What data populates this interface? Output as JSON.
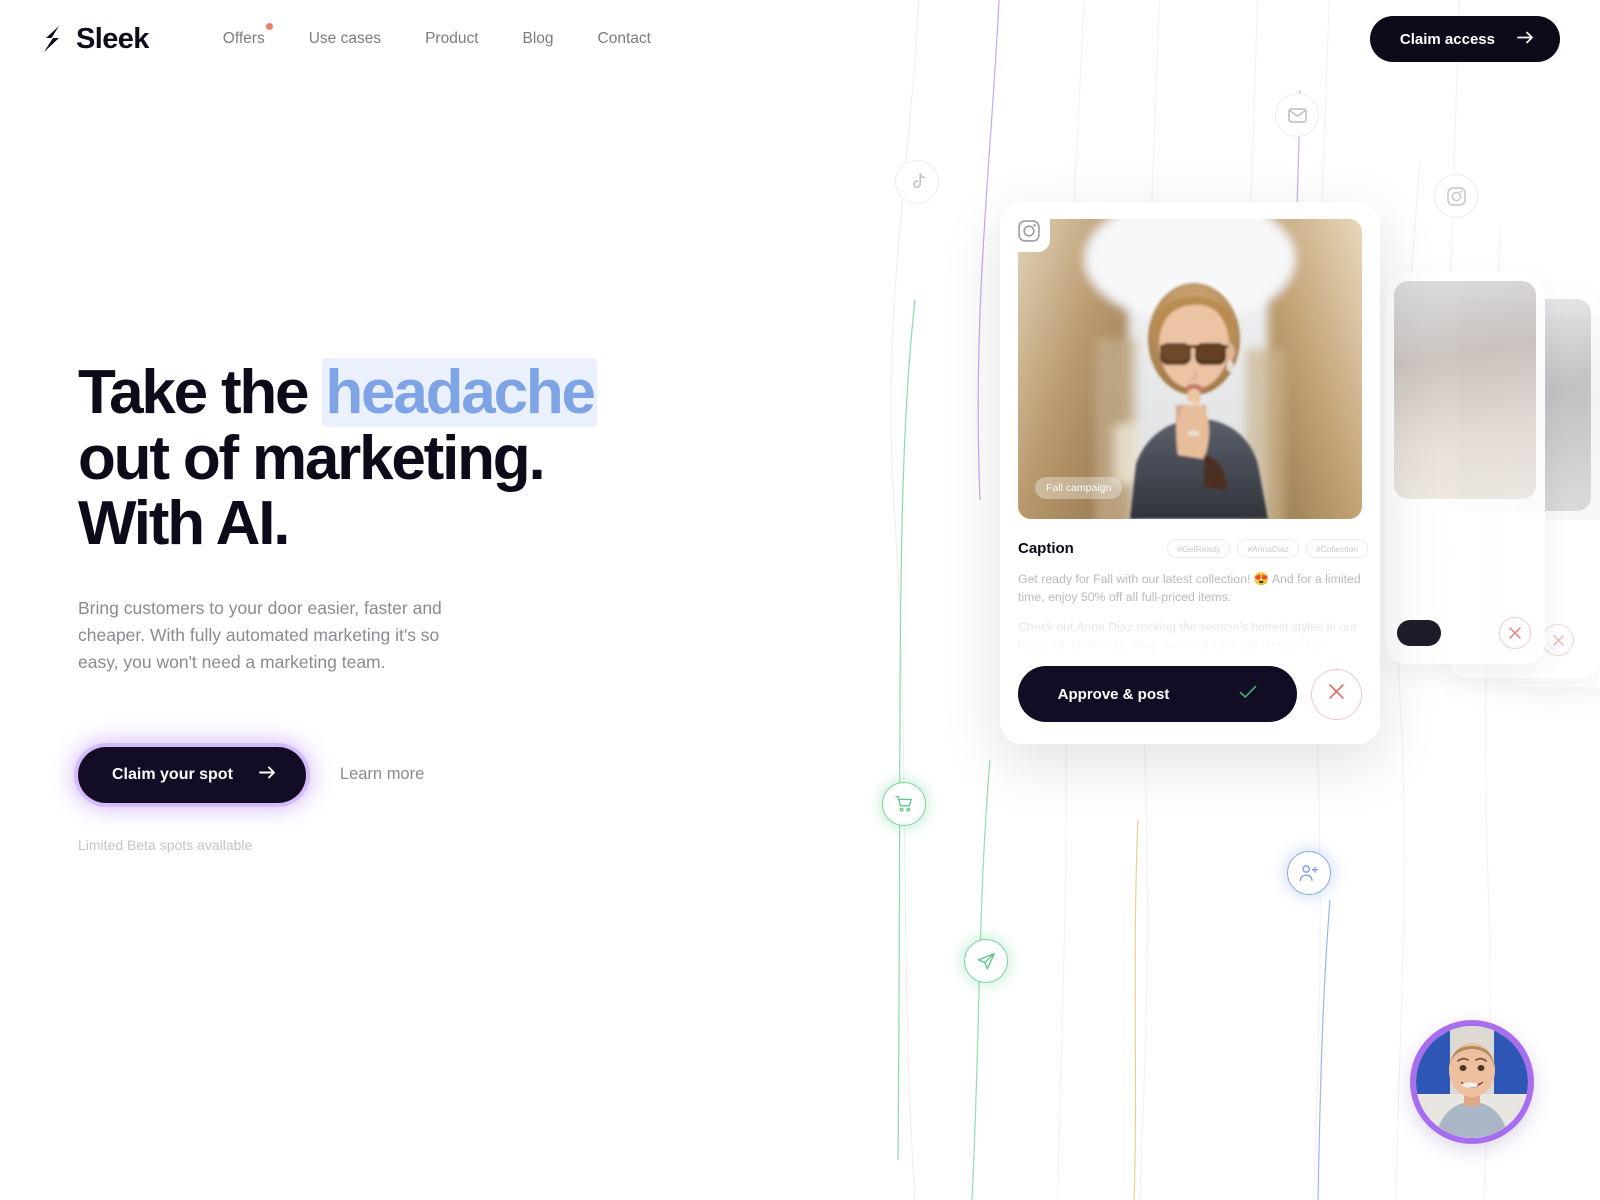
{
  "brand": {
    "name": "Sleek",
    "logo_icon": "sleek-logo-mark"
  },
  "nav": {
    "links": [
      {
        "label": "Offers",
        "badge": true
      },
      {
        "label": "Use cases",
        "badge": false
      },
      {
        "label": "Product",
        "badge": false
      },
      {
        "label": "Blog",
        "badge": false
      },
      {
        "label": "Contact",
        "badge": false
      }
    ],
    "cta": {
      "label": "Claim access",
      "icon": "arrow-right-icon"
    }
  },
  "hero": {
    "headline_part1": "Take the ",
    "headline_accent": "headache",
    "headline_part2": "out of marketing. With AI.",
    "headline_line2": "out of marketing.",
    "headline_line3": "With AI.",
    "subtitle": "Bring customers to your door easier, faster and cheaper. With fully automated marketing it's so easy, you won't need a marketing team.",
    "primary_cta": {
      "label": "Claim your spot",
      "icon": "arrow-right-icon"
    },
    "secondary_cta": {
      "label": "Learn more"
    },
    "note": "Limited Beta spots available"
  },
  "visual": {
    "float_icons": [
      {
        "name": "tiktok-icon",
        "style": "grey"
      },
      {
        "name": "mail-icon",
        "style": "grey"
      },
      {
        "name": "instagram-icon",
        "style": "grey"
      },
      {
        "name": "shopping-cart-icon",
        "style": "green"
      },
      {
        "name": "send-icon",
        "style": "green"
      },
      {
        "name": "user-plus-icon",
        "style": "blue"
      }
    ],
    "card": {
      "platform_icon": "instagram-icon",
      "image_badge": "Fall campaign",
      "caption_title": "Caption",
      "tags": [
        "#GetReady",
        "#AnnaDiaz",
        "#Collection"
      ],
      "body_p1": "Get ready for Fall with our latest collection! 😍 And for a limited time, enjoy 50% off all full-priced items.",
      "body_p2": "Check out Anna Diaz rocking the season's hottest styles in our latest ad. Don't wait, shop now and save big on your Fall",
      "approve_label": "Approve & post",
      "approve_icon": "check-icon",
      "reject_icon": "close-icon"
    },
    "ghost_cards": [
      {
        "reject_icon": "close-icon"
      },
      {
        "reject_icon": "close-icon"
      },
      {
        "reject_icon": "close-icon"
      }
    ],
    "video_bubble": {
      "name": "video-avatar"
    }
  },
  "colors": {
    "ink": "#0d0a19",
    "accent_blue": "#7ea4e6",
    "accent_blue_bg": "#eaf1fc",
    "purple_glow": "#a86ef5",
    "badge_red": "#ef7c72",
    "green": "#76d69a",
    "muted": "#8a8a92"
  }
}
